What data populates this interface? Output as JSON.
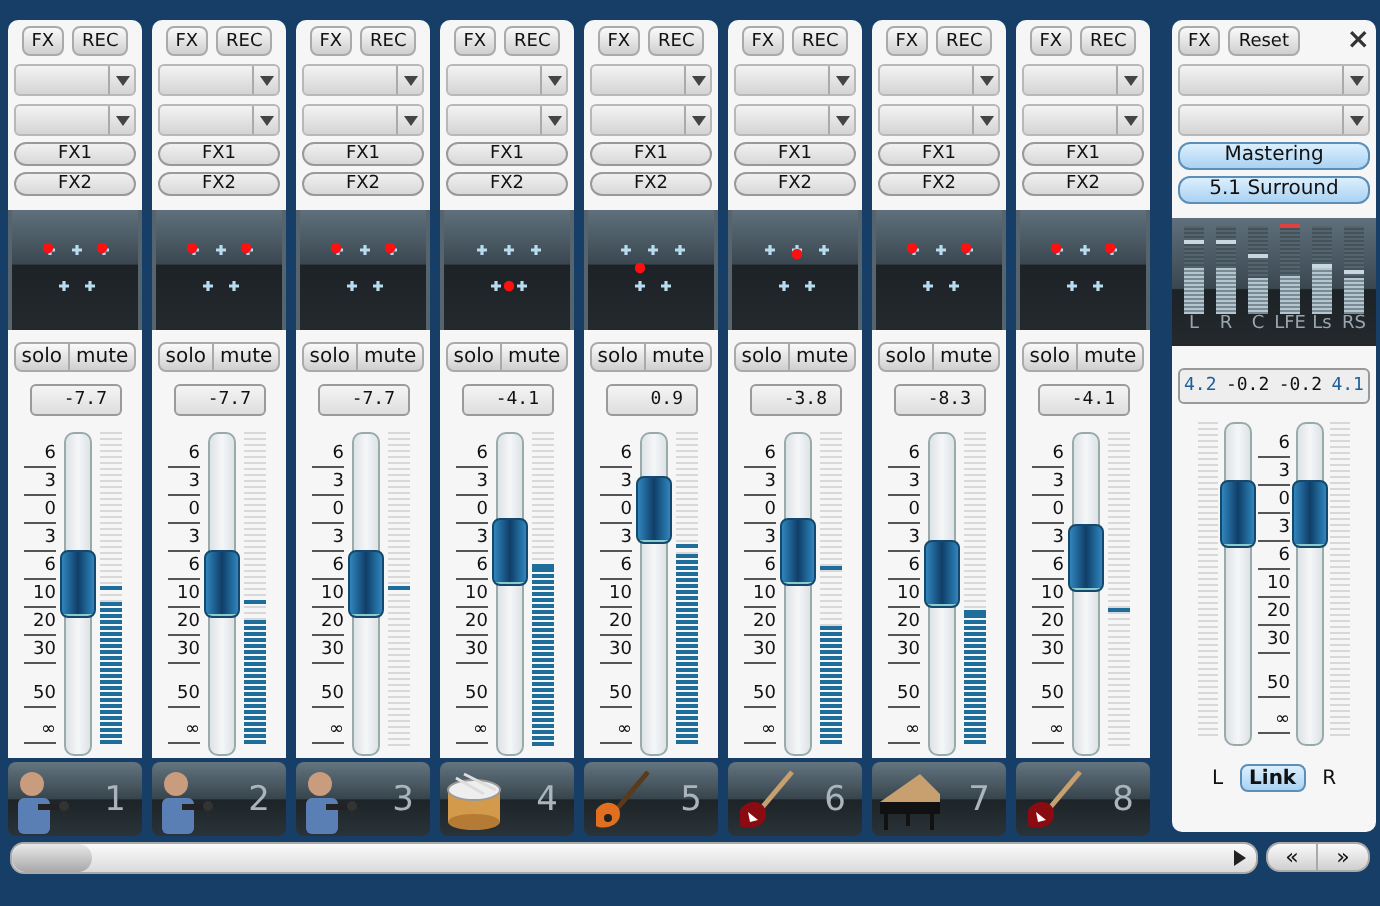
{
  "channels": [
    {
      "fx_button": "FX",
      "rec_button": "REC",
      "sends": [
        "FX1",
        "FX2"
      ],
      "panner": {
        "kind": "front-pair"
      },
      "solo": "solo",
      "mute": "mute",
      "value": "-7.7",
      "scale": [
        "6",
        "3",
        "0",
        "3",
        "6",
        "10",
        "20",
        "30",
        "50",
        "∞"
      ],
      "fader": {
        "level": 0.53
      },
      "meter": {
        "level": 0.46
      },
      "peak": {
        "level": 0.5
      },
      "instrument": {
        "kind": "singer"
      },
      "number": "1"
    },
    {
      "fx_button": "FX",
      "rec_button": "REC",
      "sends": [
        "FX1",
        "FX2"
      ],
      "panner": {
        "kind": "front-pair"
      },
      "solo": "solo",
      "mute": "mute",
      "value": "-7.7",
      "scale": [
        "6",
        "3",
        "0",
        "3",
        "6",
        "10",
        "20",
        "30",
        "50",
        "∞"
      ],
      "fader": {
        "level": 0.53
      },
      "meter": {
        "level": 0.4
      },
      "peak": {
        "level": 0.45
      },
      "instrument": {
        "kind": "singer"
      },
      "number": "2"
    },
    {
      "fx_button": "FX",
      "rec_button": "REC",
      "sends": [
        "FX1",
        "FX2"
      ],
      "panner": {
        "kind": "front-pair"
      },
      "solo": "solo",
      "mute": "mute",
      "value": "-7.7",
      "scale": [
        "6",
        "3",
        "0",
        "3",
        "6",
        "10",
        "20",
        "30",
        "50",
        "∞"
      ],
      "fader": {
        "level": 0.53
      },
      "meter": {
        "level": 0
      },
      "peak": {
        "level": 0.5
      },
      "instrument": {
        "kind": "singer"
      },
      "number": "3"
    },
    {
      "fx_button": "FX",
      "rec_button": "REC",
      "sends": [
        "FX1",
        "FX2"
      ],
      "panner": {
        "kind": "rear-center"
      },
      "solo": "solo",
      "mute": "mute",
      "value": "-4.1",
      "scale": [
        "6",
        "3",
        "0",
        "3",
        "6",
        "10",
        "20",
        "30",
        "50",
        "∞"
      ],
      "fader": {
        "level": 0.63
      },
      "meter": {
        "level": 0.57
      },
      "peak": {
        "level": 0.57
      },
      "instrument": {
        "kind": "drum"
      },
      "number": "4"
    },
    {
      "fx_button": "FX",
      "rec_button": "REC",
      "sends": [
        "FX1",
        "FX2"
      ],
      "panner": {
        "kind": "left"
      },
      "solo": "solo",
      "mute": "mute",
      "value": "0.9",
      "scale": [
        "6",
        "3",
        "0",
        "3",
        "6",
        "10",
        "20",
        "30",
        "50",
        "∞"
      ],
      "fader": {
        "level": 0.76
      },
      "meter": {
        "level": 0.61
      },
      "peak": {
        "level": 0.63
      },
      "instrument": {
        "kind": "bass-guitar"
      },
      "number": "5"
    },
    {
      "fx_button": "FX",
      "rec_button": "REC",
      "sends": [
        "FX1",
        "FX2"
      ],
      "panner": {
        "kind": "front-center"
      },
      "solo": "solo",
      "mute": "mute",
      "value": "-3.8",
      "scale": [
        "6",
        "3",
        "0",
        "3",
        "6",
        "10",
        "20",
        "30",
        "50",
        "∞"
      ],
      "fader": {
        "level": 0.63
      },
      "meter": {
        "level": 0.38
      },
      "peak": {
        "level": 0.56
      },
      "instrument": {
        "kind": "electric-guitar"
      },
      "number": "6"
    },
    {
      "fx_button": "FX",
      "rec_button": "REC",
      "sends": [
        "FX1",
        "FX2"
      ],
      "panner": {
        "kind": "front-pair"
      },
      "solo": "solo",
      "mute": "mute",
      "value": "-8.3",
      "scale": [
        "6",
        "3",
        "0",
        "3",
        "6",
        "10",
        "20",
        "30",
        "50",
        "∞"
      ],
      "fader": {
        "level": 0.56
      },
      "meter": {
        "level": 0.42
      },
      "peak": {
        "level": 0.42
      },
      "instrument": {
        "kind": "grand-piano"
      },
      "number": "7"
    },
    {
      "fx_button": "FX",
      "rec_button": "REC",
      "sends": [
        "FX1",
        "FX2"
      ],
      "panner": {
        "kind": "front-pair"
      },
      "solo": "solo",
      "mute": "mute",
      "value": "-4.1",
      "scale": [
        "6",
        "3",
        "0",
        "3",
        "6",
        "10",
        "20",
        "30",
        "50",
        "∞"
      ],
      "fader": {
        "level": 0.61
      },
      "meter": {
        "level": 0
      },
      "peak": {
        "level": 0.43
      },
      "instrument": {
        "kind": "electric-guitar"
      },
      "number": "8"
    }
  ],
  "master": {
    "fx_button": "FX",
    "reset_button": "Reset",
    "close": "×",
    "buttons": [
      {
        "label": "Mastering",
        "on": true
      },
      {
        "label": "5.1 Surround",
        "on": true
      }
    ],
    "meters": [
      {
        "label": "L",
        "level": 0.52,
        "peak": {
          "level": 0.8,
          "clip": false
        }
      },
      {
        "label": "R",
        "level": 0.52,
        "peak": {
          "level": 0.8,
          "clip": false
        }
      },
      {
        "label": "C",
        "level": 0.4,
        "peak": {
          "level": 0.64,
          "clip": false
        }
      },
      {
        "label": "LFE",
        "level": 0.44,
        "peak": {
          "level": 0.97,
          "clip": true
        }
      },
      {
        "label": "Ls",
        "level": 0.52,
        "peak": {
          "level": 0.52,
          "clip": false
        }
      },
      {
        "label": "RS",
        "level": 0.4,
        "peak": {
          "level": 0.46,
          "clip": false
        }
      }
    ],
    "readout": [
      {
        "text": "4.2",
        "kind": "peak"
      },
      {
        "text": "-0.2",
        "kind": "gain"
      },
      {
        "text": "-0.2",
        "kind": "gain"
      },
      {
        "text": "4.1",
        "kind": "peak"
      }
    ],
    "faders": [
      {
        "level": 0.72
      },
      {
        "level": 0.72
      }
    ],
    "scale": [
      "6",
      "3",
      "0",
      "3",
      "6",
      "10",
      "20",
      "30",
      "50",
      "∞"
    ],
    "left_label": "L",
    "link": {
      "label": "Link",
      "on": true
    },
    "right_label": "R"
  },
  "scrollbar": {
    "prev_label": "«",
    "next_label": "»"
  }
}
